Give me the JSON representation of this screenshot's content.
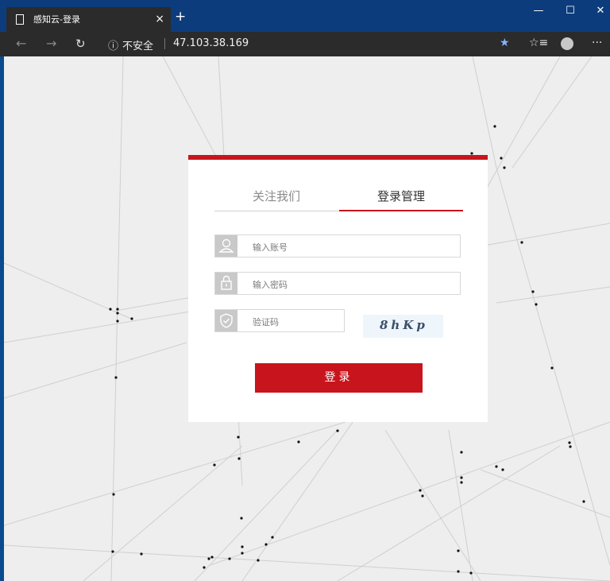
{
  "browser": {
    "tab_title": "感知云-登录",
    "tab_close": "×",
    "new_tab": "+",
    "window_controls": [
      "—",
      "☐",
      "✕"
    ],
    "security_icon": "ⓘ",
    "security_label": "不安全",
    "url": "47.103.38.169",
    "nav": {
      "back": "←",
      "forward": "→",
      "reload": "↻"
    },
    "toolbar_icons": {
      "favorite": "★",
      "favorites_list": "☆≡",
      "more": "···"
    }
  },
  "login": {
    "tabs": [
      "关注我们",
      "登录管理"
    ],
    "active_tab": 1,
    "account_placeholder": "输入账号",
    "password_placeholder": "输入密码",
    "captcha_placeholder": "验证码",
    "captcha_text": "8hKp",
    "submit_label": "登录"
  },
  "colors": {
    "accent": "#c8151d",
    "titlebar": "#0d3c7c",
    "toolbar": "#2b2b2b",
    "page_bg": "#eeeeee"
  }
}
